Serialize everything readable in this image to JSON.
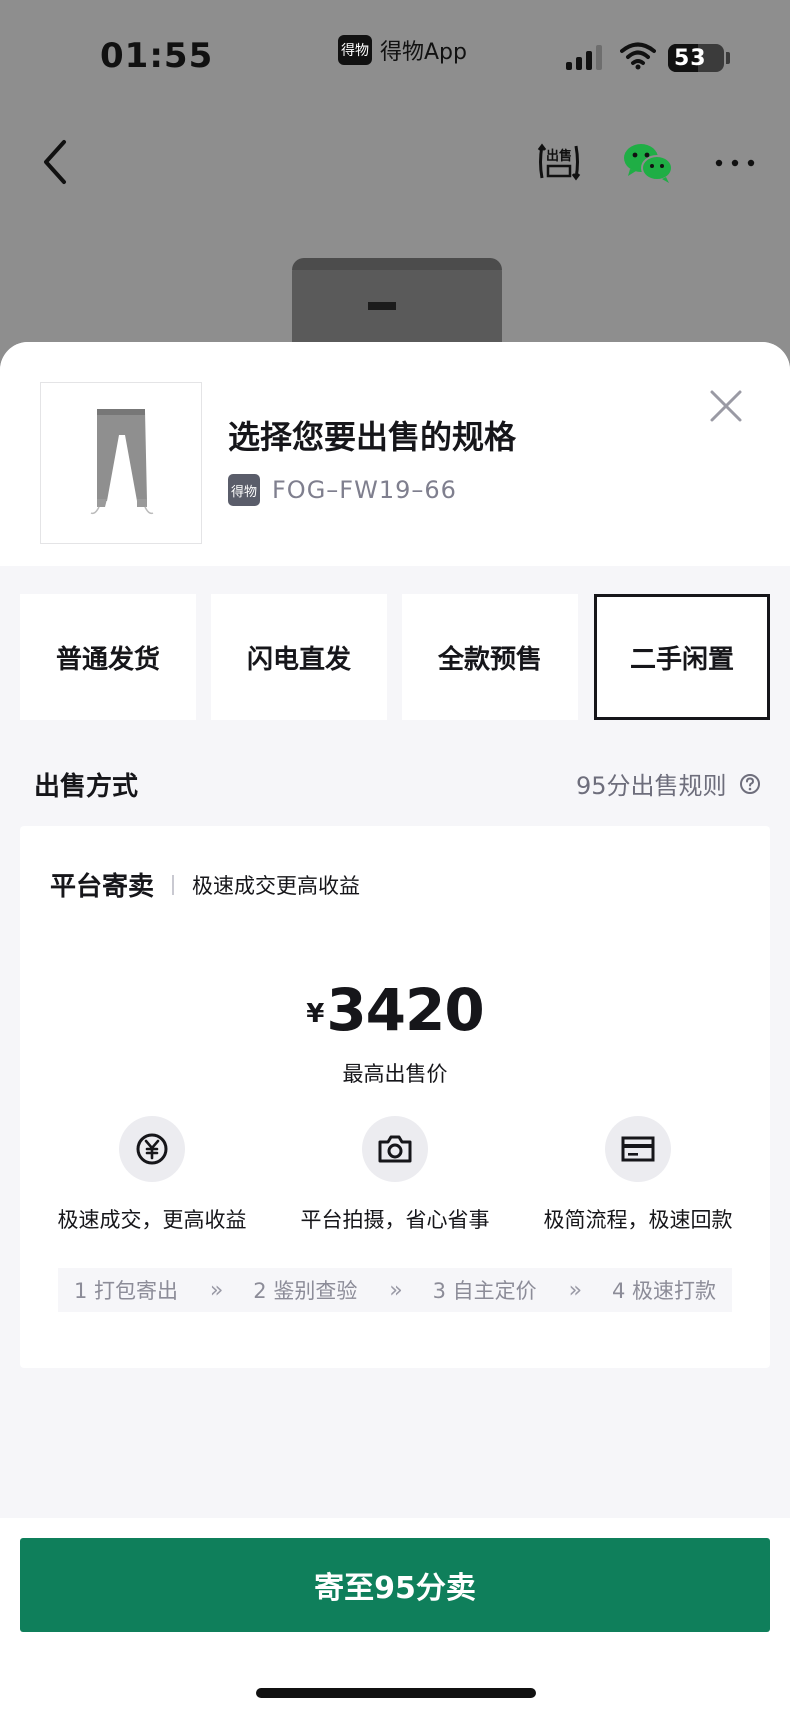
{
  "status_bar": {
    "time": "01:55",
    "app_logo": "得物",
    "app_name": "得物App",
    "battery": "53"
  },
  "nav": {
    "sell_icon_label": "出售"
  },
  "sheet": {
    "title": "选择您要出售的规格",
    "sku_logo": "得物",
    "sku": "FOG–FW19–66"
  },
  "tabs": [
    {
      "label": "普通发货",
      "selected": false
    },
    {
      "label": "闪电直发",
      "selected": false
    },
    {
      "label": "全款预售",
      "selected": false
    },
    {
      "label": "二手闲置",
      "selected": true
    }
  ],
  "sell_method": {
    "label": "出售方式",
    "rules_link": "95分出售规则"
  },
  "card": {
    "title": "平台寄卖",
    "subtitle": "极速成交更高收益",
    "currency": "¥",
    "price": "3420",
    "price_caption": "最高出售价",
    "features": [
      {
        "icon": "yuan-icon",
        "text": "极速成交，更高收益"
      },
      {
        "icon": "camera-icon",
        "text": "平台拍摄，省心省事"
      },
      {
        "icon": "card-icon",
        "text": "极简流程，极速回款"
      }
    ],
    "steps": [
      "1 打包寄出",
      "2 鉴别查验",
      "3 自主定价",
      "4 极速打款"
    ],
    "step_arrow": "»"
  },
  "action": {
    "button_label": "寄至95分卖"
  },
  "colors": {
    "primary_button": "#0f7f5b",
    "wechat": "#1fae45",
    "overlay": "#8e8e8e"
  }
}
